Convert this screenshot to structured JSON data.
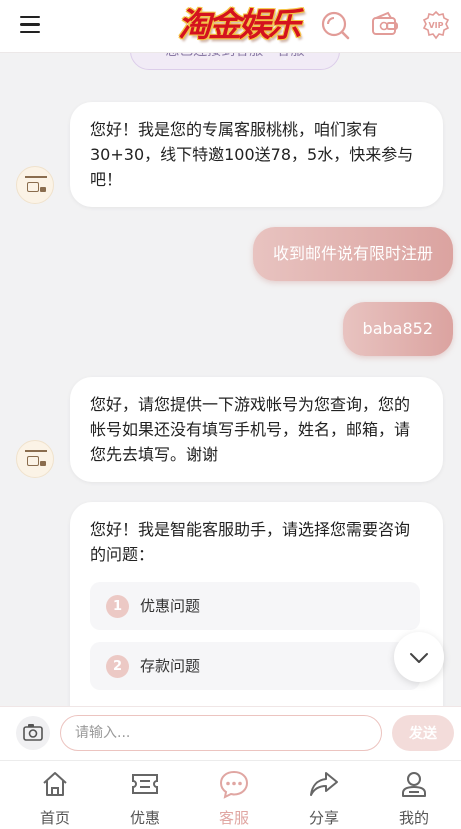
{
  "header": {
    "logo_text": "淘金娱乐",
    "icons": [
      "menu-icon",
      "search-icon",
      "wallet-icon",
      "vip-icon"
    ],
    "vip_badge": "VIP"
  },
  "chat": {
    "notice": "您已连接到客服 · 客服",
    "messages": [
      {
        "from": "agent",
        "text": "您好！我是您的专属客服桃桃，咱们家有30+30，线下特邀100送78，5水，快来参与吧！"
      },
      {
        "from": "user",
        "text": "收到邮件说有限时注册"
      },
      {
        "from": "user",
        "text": "baba852"
      },
      {
        "from": "agent",
        "text": "您好，请您提供一下游戏帐号为您查询，您的帐号如果还没有填写手机号，姓名，邮箱，请您先去填写。谢谢"
      },
      {
        "from": "agent",
        "text": "您好！我是智能客服助手，请选择您需要咨询的问题："
      }
    ],
    "options": [
      {
        "num": "1",
        "label": "优惠问题"
      },
      {
        "num": "2",
        "label": "存款问题"
      }
    ]
  },
  "input": {
    "placeholder": "请输入...",
    "send_label": "发送"
  },
  "tabs": [
    {
      "label": "首页",
      "icon": "home-icon",
      "active": false
    },
    {
      "label": "优惠",
      "icon": "ticket-icon",
      "active": false
    },
    {
      "label": "客服",
      "icon": "chat-icon",
      "active": true
    },
    {
      "label": "分享",
      "icon": "share-icon",
      "active": false
    },
    {
      "label": "我的",
      "icon": "user-icon",
      "active": false
    }
  ],
  "colors": {
    "accent": "#e0a6a2",
    "user_bubble_start": "#e8c3c0",
    "user_bubble_end": "#dba3a0",
    "logo_red": "#d4121e"
  }
}
